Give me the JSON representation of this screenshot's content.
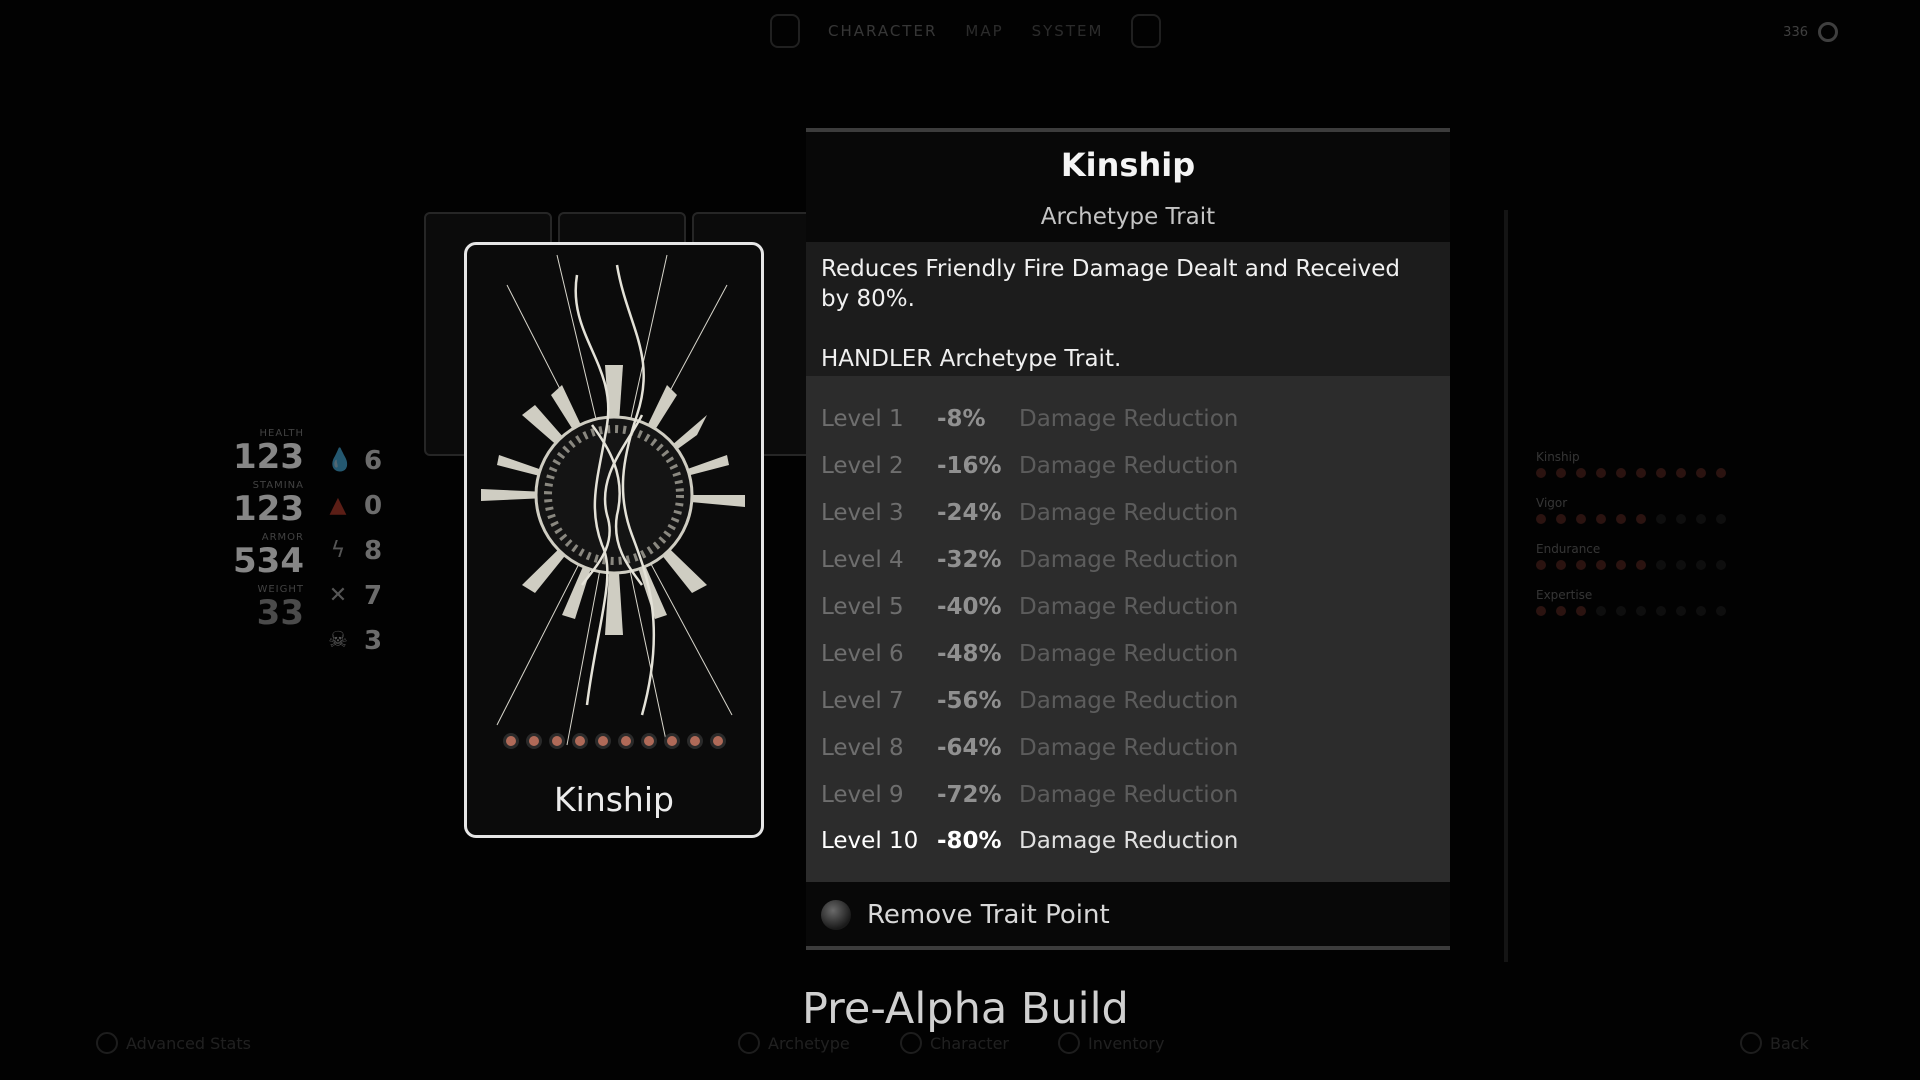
{
  "nav": {
    "tabs": [
      "CHARACTER",
      "MAP",
      "SYSTEM"
    ],
    "active": "CHARACTER"
  },
  "currency": {
    "value": "336"
  },
  "stats": [
    {
      "label": "HEALTH",
      "value": "123"
    },
    {
      "label": "STAMINA",
      "value": "123"
    },
    {
      "label": "ARMOR",
      "value": "534"
    },
    {
      "label": "WEIGHT",
      "value": "33"
    }
  ],
  "resistances": [
    {
      "icon": "bleed-icon",
      "value": "6",
      "color": "#c84030"
    },
    {
      "icon": "fire-icon",
      "value": "0",
      "color": "#c84030"
    },
    {
      "icon": "shock-icon",
      "value": "8",
      "color": "#bbbbbb"
    },
    {
      "icon": "blight-icon",
      "value": "7",
      "color": "#bbbbbb"
    },
    {
      "icon": "corrosion-icon",
      "value": "3",
      "color": "#bbbbbb"
    }
  ],
  "card": {
    "title": "Kinship",
    "pips_filled": 10,
    "pips_total": 10,
    "pip_color": "#b06a58"
  },
  "panel": {
    "title": "Kinship",
    "subtitle": "Archetype Trait",
    "description_1": "Reduces Friendly Fire Damage Dealt and Received by 80%.",
    "description_2": "HANDLER Archetype Trait.",
    "levels": [
      {
        "name": "Level 1",
        "value": "-8%",
        "effect": "Damage Reduction"
      },
      {
        "name": "Level 2",
        "value": "-16%",
        "effect": "Damage Reduction"
      },
      {
        "name": "Level 3",
        "value": "-24%",
        "effect": "Damage Reduction"
      },
      {
        "name": "Level 4",
        "value": "-32%",
        "effect": "Damage Reduction"
      },
      {
        "name": "Level 5",
        "value": "-40%",
        "effect": "Damage Reduction"
      },
      {
        "name": "Level 6",
        "value": "-48%",
        "effect": "Damage Reduction"
      },
      {
        "name": "Level 7",
        "value": "-56%",
        "effect": "Damage Reduction"
      },
      {
        "name": "Level 8",
        "value": "-64%",
        "effect": "Damage Reduction"
      },
      {
        "name": "Level 9",
        "value": "-72%",
        "effect": "Damage Reduction"
      },
      {
        "name": "Level 10",
        "value": "-80%",
        "effect": "Damage Reduction"
      }
    ],
    "current_level": 10,
    "remove_label": "Remove Trait Point"
  },
  "archetype_bars": [
    {
      "name": "Kinship",
      "filled": 10,
      "total": 10
    },
    {
      "name": "Vigor",
      "filled": 6,
      "total": 10
    },
    {
      "name": "Endurance",
      "filled": 6,
      "total": 10
    },
    {
      "name": "Expertise",
      "filled": 3,
      "total": 10
    }
  ],
  "build_label": "Pre-Alpha Build",
  "bottom_hints": [
    "Advanced Stats",
    "Archetype",
    "Character",
    "Inventory",
    "Back"
  ]
}
